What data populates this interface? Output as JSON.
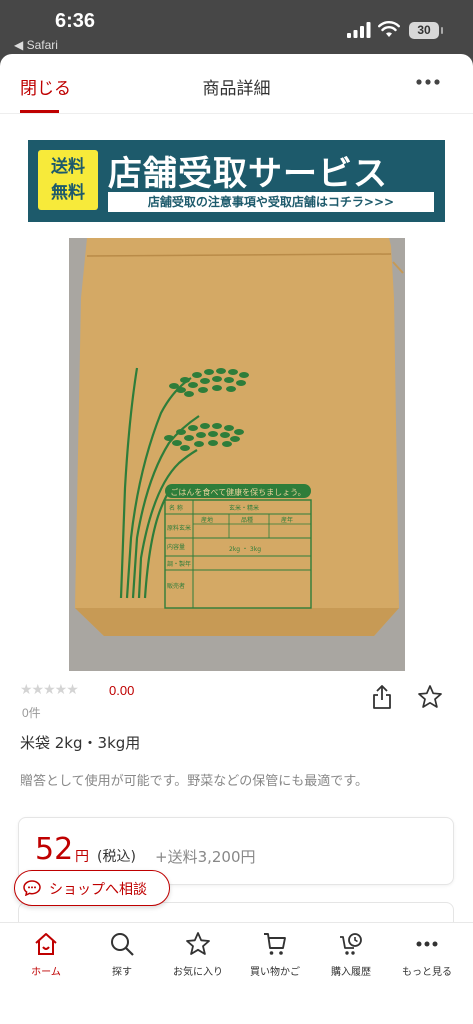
{
  "status_bar": {
    "time": "6:36",
    "back_app": "◀ Safari",
    "battery": "30"
  },
  "nav": {
    "close_label": "閉じる",
    "title": "商品詳細"
  },
  "banner": {
    "badge_line1": "送料",
    "badge_line2": "無料",
    "title": "店舗受取サービス",
    "subtitle": "店舗受取の注意事項や受取店舗はコチラ>>>"
  },
  "product_image": {
    "slogan": "ごはんを食べて健康を保ちましょう。",
    "field_name": "名 称",
    "field_grain": "玄米・精米",
    "field_origin": "原料玄米",
    "field_place": "産地",
    "field_variety": "品種",
    "field_year": "産年",
    "field_weight": "内容量",
    "field_weight_value": "2kg ・ 3kg",
    "field_date": "調・製年",
    "field_seller": "販売者"
  },
  "rating": {
    "stars": "★★★★★",
    "value": "0.00",
    "count": "0件"
  },
  "product": {
    "name": "米袋 2kg・3kg用",
    "description": "贈答として使用が可能です。野菜などの保管にも最適です。"
  },
  "price": {
    "amount": "52",
    "unit": "円",
    "tax": "(税込)",
    "shipping": "+送料3,200円"
  },
  "consult_button": {
    "label": "ショップへ相談"
  },
  "tabs": [
    {
      "label": "ホーム",
      "icon": "home-icon"
    },
    {
      "label": "探す",
      "icon": "search-icon"
    },
    {
      "label": "お気に入り",
      "icon": "star-icon"
    },
    {
      "label": "買い物かご",
      "icon": "cart-icon"
    },
    {
      "label": "購入履歴",
      "icon": "history-icon"
    },
    {
      "label": "もっと見る",
      "icon": "more-icon"
    }
  ],
  "colors": {
    "accent": "#bf0000",
    "banner": "#1d5a6b",
    "badge": "#f7ea3a",
    "bag": "#d4a965",
    "print": "#2e7d3a"
  }
}
